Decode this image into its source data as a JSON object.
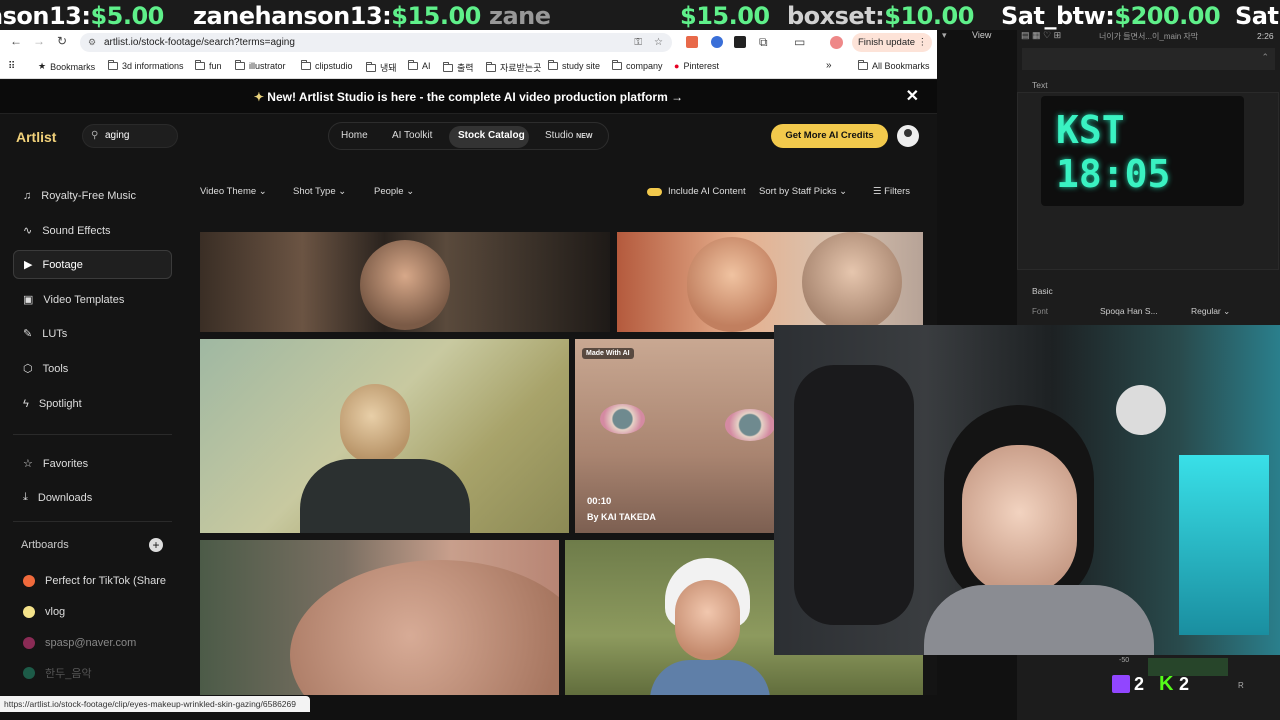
{
  "ticker": [
    {
      "name": "nson13:",
      "amount": "$5.00"
    },
    {
      "name": "zanehanson13:",
      "amount": "$15.00"
    },
    {
      "name": "zane",
      "amount": "$15.00"
    },
    {
      "name": "boxset:",
      "amount": "$10.00"
    },
    {
      "name": "Sat_btw:",
      "amount": "$200.00"
    },
    {
      "name": "Sat",
      "amount": ""
    }
  ],
  "browser": {
    "url": "artlist.io/stock-footage/search?terms=aging",
    "finish_update": "Finish update",
    "bookmarks": [
      "Bookmarks",
      "3d informations",
      "fun",
      "illustrator",
      "clipstudio",
      "냉돼",
      "AI",
      "출력",
      "자료받는곳",
      "study site",
      "company",
      "Pinterest"
    ],
    "all_bookmarks": "All Bookmarks"
  },
  "site": {
    "banner": "New! Artlist Studio is here - the complete AI video production platform →",
    "logo": "Artlist",
    "search_value": "aging",
    "nav": [
      "Home",
      "AI Toolkit",
      "Stock Catalog",
      "Studio"
    ],
    "nav_badge": "NEW",
    "credits_button": "Get More AI Credits",
    "sidebar": [
      "Royalty-Free Music",
      "Sound Effects",
      "Footage",
      "Video Templates",
      "LUTs",
      "Tools",
      "Spotlight"
    ],
    "sidebar_secondary": [
      "Favorites",
      "Downloads"
    ],
    "artboards_title": "Artboards",
    "artboards": [
      {
        "label": "Perfect for TikTok (Share",
        "color": "#f06a3c"
      },
      {
        "label": "vlog",
        "color": "#f4e28a"
      },
      {
        "label": "spasp@naver.com",
        "color": "#8a2b55"
      },
      {
        "label": "한두_음악",
        "color": "#1d5b48"
      }
    ],
    "filters": [
      "Video Theme",
      "Shot Type",
      "People"
    ],
    "include_ai": "Include AI Content",
    "sort": "Sort by Staff Picks",
    "filters_button": "Filters",
    "clip": {
      "badge": "Made With AI",
      "duration": "00:10",
      "author": "By KAI TAKEDA"
    }
  },
  "status_url": "https://artlist.io/stock-footage/clip/eyes-makeup-wrinkled-skin-gazing/6586269",
  "obs": {
    "view_menu": "View",
    "timer": "2:26",
    "doc_title": "너이가 들면서...이_main 자막",
    "text_section": "Text",
    "basic_section": "Basic",
    "font_label": "Font",
    "font_value": "Spoqa Han S...",
    "font_style": "Regular",
    "clock_label": "KST",
    "clock_time": "18:05",
    "level": "-50",
    "channel": "R",
    "twitch_count": "2",
    "kick_count": "2"
  },
  "colors": {
    "accent": "#f2c94c",
    "ticker_amount": "#5ff08a",
    "clock": "#3af2c2"
  }
}
